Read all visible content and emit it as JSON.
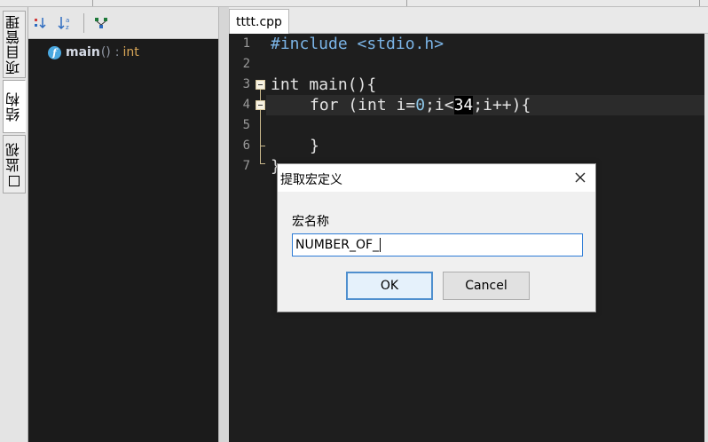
{
  "side_tabs": {
    "project": "项目管理",
    "structure": "结构",
    "watch": "监视"
  },
  "structure_panel": {
    "toolbar": {
      "sort_type_icon": "sort-by-type-icon",
      "sort_alpha_icon": "sort-alpha-icon",
      "show_inherited_icon": "class-hierarchy-icon"
    },
    "items": [
      {
        "icon": "function-icon",
        "icon_letter": "f",
        "name": "main",
        "params": "()",
        "sep": ":",
        "type": "int"
      }
    ]
  },
  "editor": {
    "tab_title": "tttt.cpp",
    "line_numbers": [
      "1",
      "2",
      "3",
      "4",
      "5",
      "6",
      "7"
    ],
    "lines": {
      "l1": "#include <stdio.h>",
      "l3_kw": "int",
      "l3_rest": " main(){",
      "l4_for": "for",
      "l4_a": " (int i=",
      "l4_zero": "0",
      "l4_b": ";i<",
      "l4_num": "34",
      "l4_c": ";i++){",
      "l6": "}",
      "l7": "}"
    }
  },
  "dialog": {
    "title": "提取宏定义",
    "close_icon": "close-icon",
    "label": "宏名称",
    "input_value": "NUMBER_OF_",
    "ok_label": "OK",
    "cancel_label": "Cancel"
  },
  "colors": {
    "editor_bg": "#1e1e1e",
    "panel_bg": "#1b1b1b",
    "preprocessor": "#7bb4e6",
    "number": "#e4b86d",
    "type": "#d8a657",
    "focus_border": "#2c7bd6"
  }
}
